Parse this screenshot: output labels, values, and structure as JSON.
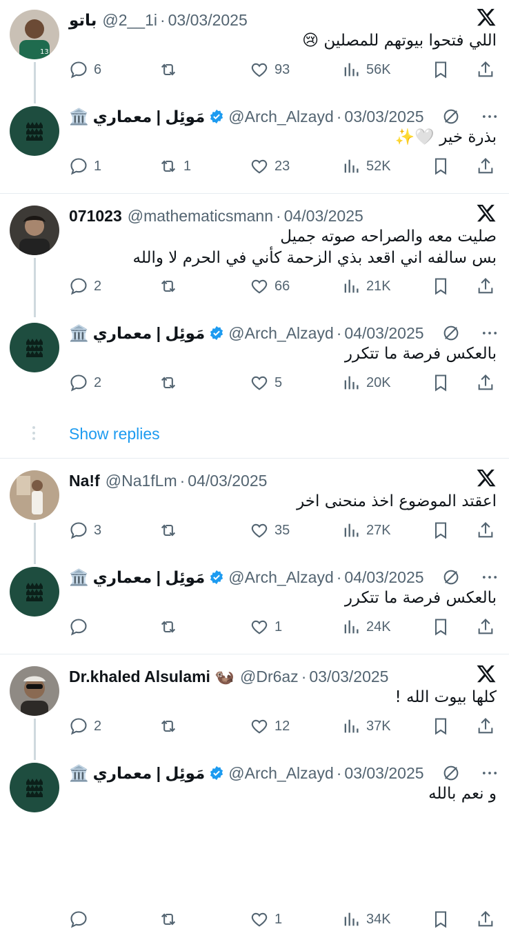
{
  "colors": {
    "accent": "#1d9bf0",
    "muted": "#536471",
    "avatar_green": "#1e4d3f",
    "line": "#cfd9de"
  },
  "threads": [
    {
      "reply": {
        "name": "باتو",
        "handle": "@2__1i",
        "date": "03/03/2025",
        "text": "اللي فتحوا بيوتهم للمصلين 😢",
        "replies": "6",
        "retweets": "",
        "likes": "93",
        "views": "56K"
      },
      "answer": {
        "name": "مَوئِل | معماري",
        "emoji": "🏛️",
        "handle": "@Arch_Alzayd",
        "date": "03/03/2025",
        "text": "بذرة خير 🤍✨",
        "replies": "1",
        "retweets": "1",
        "likes": "23",
        "views": "52K"
      }
    },
    {
      "reply": {
        "name": "071023",
        "handle": "@mathematicsmann",
        "date": "04/03/2025",
        "text": "صليت معه والصراحه صوته جميل\nبس سالفه اني اقعد بذي الزحمة كأني في الحرم لا والله",
        "replies": "2",
        "retweets": "",
        "likes": "66",
        "views": "21K"
      },
      "answer": {
        "name": "مَوئِل | معماري",
        "emoji": "🏛️",
        "handle": "@Arch_Alzayd",
        "date": "04/03/2025",
        "text": "بالعكس فرصة ما تتكرر",
        "replies": "2",
        "retweets": "",
        "likes": "5",
        "views": "20K"
      }
    },
    {
      "reply": {
        "name": "Na!f",
        "handle": "@Na1fLm",
        "date": "04/03/2025",
        "text": "اعقتد الموضوع اخذ منحنى اخر",
        "replies": "3",
        "retweets": "",
        "likes": "35",
        "views": "27K"
      },
      "answer": {
        "name": "مَوئِل | معماري",
        "emoji": "🏛️",
        "handle": "@Arch_Alzayd",
        "date": "04/03/2025",
        "text": "بالعكس فرصة ما تتكرر",
        "replies": "",
        "retweets": "",
        "likes": "1",
        "views": "24K"
      }
    },
    {
      "reply": {
        "name": "Dr.khaled Alsulami 🦦",
        "handle": "@Dr6az",
        "date": "03/03/2025",
        "text": "كلها بيوت الله !",
        "replies": "2",
        "retweets": "",
        "likes": "12",
        "views": "37K"
      },
      "answer": {
        "name": "مَوئِل | معماري",
        "emoji": "🏛️",
        "handle": "@Arch_Alzayd",
        "date": "03/03/2025",
        "text": "و نعم بالله",
        "replies": "",
        "retweets": "",
        "likes": "1",
        "views": "34K"
      }
    }
  ],
  "show_replies": "Show replies"
}
